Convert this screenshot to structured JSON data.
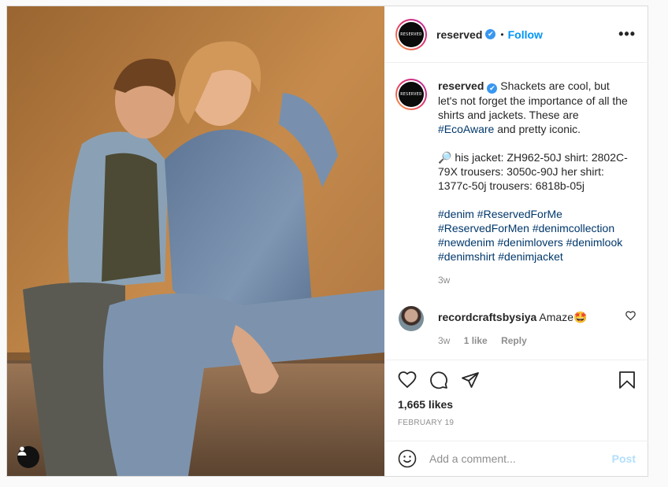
{
  "header": {
    "avatar_text": "RESERVED",
    "username": "reserved",
    "verified": "✔",
    "separator": "•",
    "follow_label": "Follow",
    "more_label": "•••"
  },
  "caption": {
    "username": "reserved",
    "paragraph1": "Shackets are cool, but let's not forget the importance of all the shirts and jackets. These are ",
    "hashtag_inline": "#EcoAware",
    "paragraph1_end": " and pretty iconic.",
    "paragraph2": "🔎 his jacket: ZH962-50J shirt: 2802C-79X trousers: 3050c-90J her shirt: 1377c-50j trousers: 6818b-05j",
    "hashtags": "#denim #ReservedForMe #ReservedForMen #denimcollection #newdenim #denimlovers #denimlook #denimshirt #denimjacket",
    "age": "3w"
  },
  "comment": {
    "username": "recordcraftsbysiya",
    "text": "Amaze🤩",
    "age": "3w",
    "likes": "1 like",
    "reply": "Reply"
  },
  "actions": {
    "likes": "1,665 likes",
    "date": "FEBRUARY 19"
  },
  "add_comment": {
    "placeholder": "Add a comment...",
    "post_label": "Post"
  },
  "colors": {
    "link_blue": "#0095f6",
    "hashtag": "#00376b",
    "post_disabled": "#b2dffc"
  }
}
